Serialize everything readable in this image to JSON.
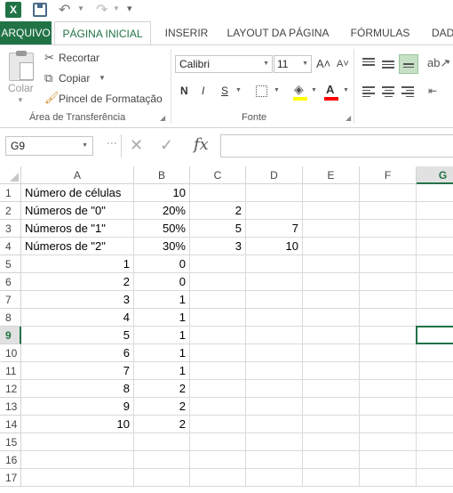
{
  "qat": {
    "app_icon": "X",
    "save_icon": "save-icon",
    "undo_icon": "undo-icon",
    "redo_icon": "redo-icon",
    "undo_glyph": "↶",
    "redo_glyph": "↷",
    "more_glyph": "▾"
  },
  "tabs": [
    "ARQUIVO",
    "PÁGINA INICIAL",
    "INSERIR",
    "LAYOUT DA PÁGINA",
    "FÓRMULAS",
    "DAD"
  ],
  "ribbon": {
    "paste_label": "Colar",
    "cut_label": "Recortar",
    "copy_label": "Copiar",
    "format_painter_label": "Pincel de Formatação",
    "clipboard_group": "Área de Transferência",
    "font_group": "Fonte",
    "font_name": "Calibri",
    "font_size": "11",
    "grow_glyph": "A˄",
    "shrink_glyph": "A˅",
    "bold": "N",
    "italic": "I",
    "underline": "S",
    "font_color_letter": "A",
    "fill_color": "#ffff00",
    "font_color": "#ff0000",
    "accent": "#217346"
  },
  "formula_bar": {
    "name_box": "G9",
    "cancel_glyph": "✕",
    "enter_glyph": "✓",
    "fx_label": "fx",
    "content": ""
  },
  "columns": [
    "A",
    "B",
    "C",
    "D",
    "E",
    "F",
    "G"
  ],
  "selected_column": "G",
  "selected_row": "9",
  "rows": [
    {
      "num": "1",
      "a": "Número de células",
      "b": "10",
      "c": "",
      "d": ""
    },
    {
      "num": "2",
      "a": "Números de \"0\"",
      "b": "20%",
      "c": "2",
      "d": ""
    },
    {
      "num": "3",
      "a": "Números de \"1\"",
      "b": "50%",
      "c": "5",
      "d": "7"
    },
    {
      "num": "4",
      "a": "Números de \"2\"",
      "b": "30%",
      "c": "3",
      "d": "10"
    },
    {
      "num": "5",
      "a": "1",
      "b": "0",
      "c": "",
      "d": ""
    },
    {
      "num": "6",
      "a": "2",
      "b": "0",
      "c": "",
      "d": ""
    },
    {
      "num": "7",
      "a": "3",
      "b": "1",
      "c": "",
      "d": ""
    },
    {
      "num": "8",
      "a": "4",
      "b": "1",
      "c": "",
      "d": ""
    },
    {
      "num": "9",
      "a": "5",
      "b": "1",
      "c": "",
      "d": ""
    },
    {
      "num": "10",
      "a": "6",
      "b": "1",
      "c": "",
      "d": ""
    },
    {
      "num": "11",
      "a": "7",
      "b": "1",
      "c": "",
      "d": ""
    },
    {
      "num": "12",
      "a": "8",
      "b": "2",
      "c": "",
      "d": ""
    },
    {
      "num": "13",
      "a": "9",
      "b": "2",
      "c": "",
      "d": ""
    },
    {
      "num": "14",
      "a": "10",
      "b": "2",
      "c": "",
      "d": ""
    },
    {
      "num": "15",
      "a": "",
      "b": "",
      "c": "",
      "d": ""
    },
    {
      "num": "16",
      "a": "",
      "b": "",
      "c": "",
      "d": ""
    },
    {
      "num": "17",
      "a": "",
      "b": "",
      "c": "",
      "d": ""
    }
  ]
}
